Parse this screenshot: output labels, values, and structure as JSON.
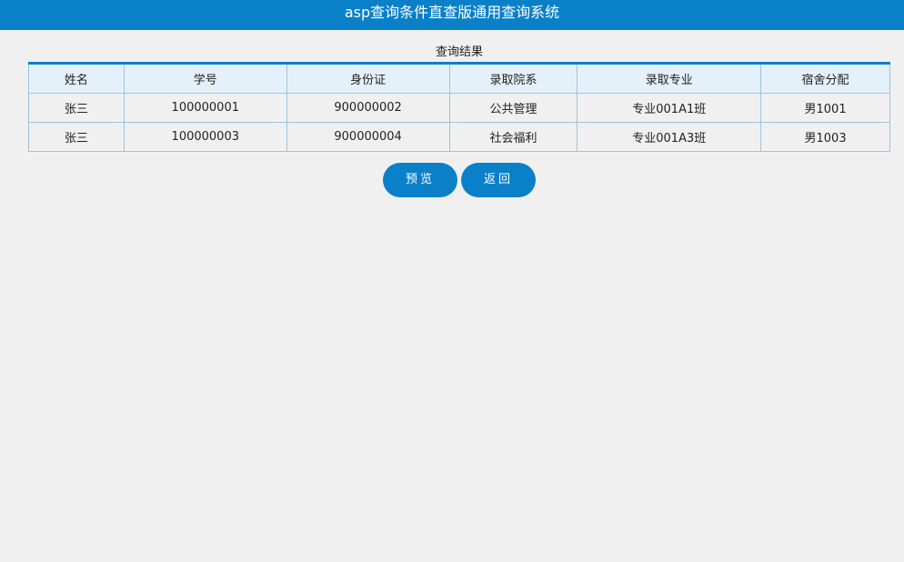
{
  "header": {
    "title": "asp查询条件直查版通用查询系统"
  },
  "results": {
    "caption": "查询结果",
    "columns": [
      "姓名",
      "学号",
      "身份证",
      "录取院系",
      "录取专业",
      "宿舍分配"
    ],
    "rows": [
      [
        "张三",
        "100000001",
        "900000002",
        "公共管理",
        "专业001A1班",
        "男1001"
      ],
      [
        "张三",
        "100000003",
        "900000004",
        "社会福利",
        "专业001A3班",
        "男1003"
      ]
    ]
  },
  "actions": {
    "preview_label": "预览",
    "back_label": "返回"
  }
}
